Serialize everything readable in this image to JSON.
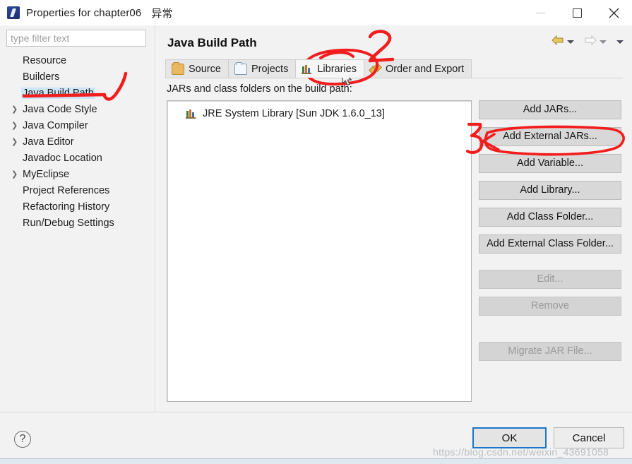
{
  "window": {
    "title": "Properties for chapter06",
    "extra_title": "异常",
    "icon": "eclipse-app-icon",
    "controls": {
      "minimize": "minimize-icon",
      "maximize": "maximize-icon",
      "close": "close-icon"
    }
  },
  "sidebar": {
    "filter_placeholder": "type filter text",
    "filter_value": "",
    "items": [
      {
        "label": "Resource",
        "expandable": false,
        "selected": false
      },
      {
        "label": "Builders",
        "expandable": false,
        "selected": false
      },
      {
        "label": "Java Build Path",
        "expandable": false,
        "selected": true
      },
      {
        "label": "Java Code Style",
        "expandable": true,
        "selected": false
      },
      {
        "label": "Java Compiler",
        "expandable": true,
        "selected": false
      },
      {
        "label": "Java Editor",
        "expandable": true,
        "selected": false
      },
      {
        "label": "Javadoc Location",
        "expandable": false,
        "selected": false
      },
      {
        "label": "MyEclipse",
        "expandable": true,
        "selected": false
      },
      {
        "label": "Project References",
        "expandable": false,
        "selected": false
      },
      {
        "label": "Refactoring History",
        "expandable": false,
        "selected": false
      },
      {
        "label": "Run/Debug Settings",
        "expandable": false,
        "selected": false
      }
    ]
  },
  "page": {
    "title": "Java Build Path",
    "nav": {
      "back_icon": "back-arrow-icon",
      "back_menu_icon": "chevron-down-icon",
      "forward_icon": "forward-arrow-icon",
      "forward_menu_icon": "chevron-down-icon",
      "view_menu_icon": "chevron-down-icon"
    },
    "tabs": [
      {
        "label": "Source",
        "icon": "folder-gold-icon",
        "active": false
      },
      {
        "label": "Projects",
        "icon": "folder-blue-icon",
        "active": false
      },
      {
        "label": "Libraries",
        "icon": "books-icon",
        "active": true
      },
      {
        "label": "Order and Export",
        "icon": "order-export-icon",
        "active": false
      }
    ],
    "section_label": "JARs and class folders on the build path:",
    "entries": [
      {
        "label": "JRE System Library [Sun JDK 1.6.0_13]",
        "icon": "books-icon"
      }
    ],
    "buttons": [
      {
        "label": "Add JARs...",
        "enabled": true
      },
      {
        "label": "Add External JARs...",
        "enabled": true
      },
      {
        "label": "Add Variable...",
        "enabled": true
      },
      {
        "label": "Add Library...",
        "enabled": true
      },
      {
        "label": "Add Class Folder...",
        "enabled": true
      },
      {
        "label": "Add External Class Folder...",
        "enabled": true
      },
      {
        "label": "Edit...",
        "enabled": false
      },
      {
        "label": "Remove",
        "enabled": false
      },
      {
        "label": "Migrate JAR File...",
        "enabled": false
      }
    ]
  },
  "footer": {
    "help_icon": "help-question-icon",
    "ok_label": "OK",
    "cancel_label": "Cancel"
  },
  "watermark": "https://blog.csdn.net/weixin_43691058",
  "annotations": {
    "color": "#f21d1d",
    "marks": [
      {
        "id": "step-1",
        "type": "arrow-hook",
        "target": "sidebar-item-java-build-path"
      },
      {
        "id": "step-2",
        "type": "number",
        "text": "2",
        "target": "tab-libraries"
      },
      {
        "id": "step-2-circle",
        "type": "ellipse",
        "target": "tab-libraries"
      },
      {
        "id": "step-3",
        "type": "number",
        "text": "3",
        "target": "add-external-jars-button"
      },
      {
        "id": "step-3-circle",
        "type": "ellipse",
        "target": "add-external-jars-button"
      }
    ]
  }
}
